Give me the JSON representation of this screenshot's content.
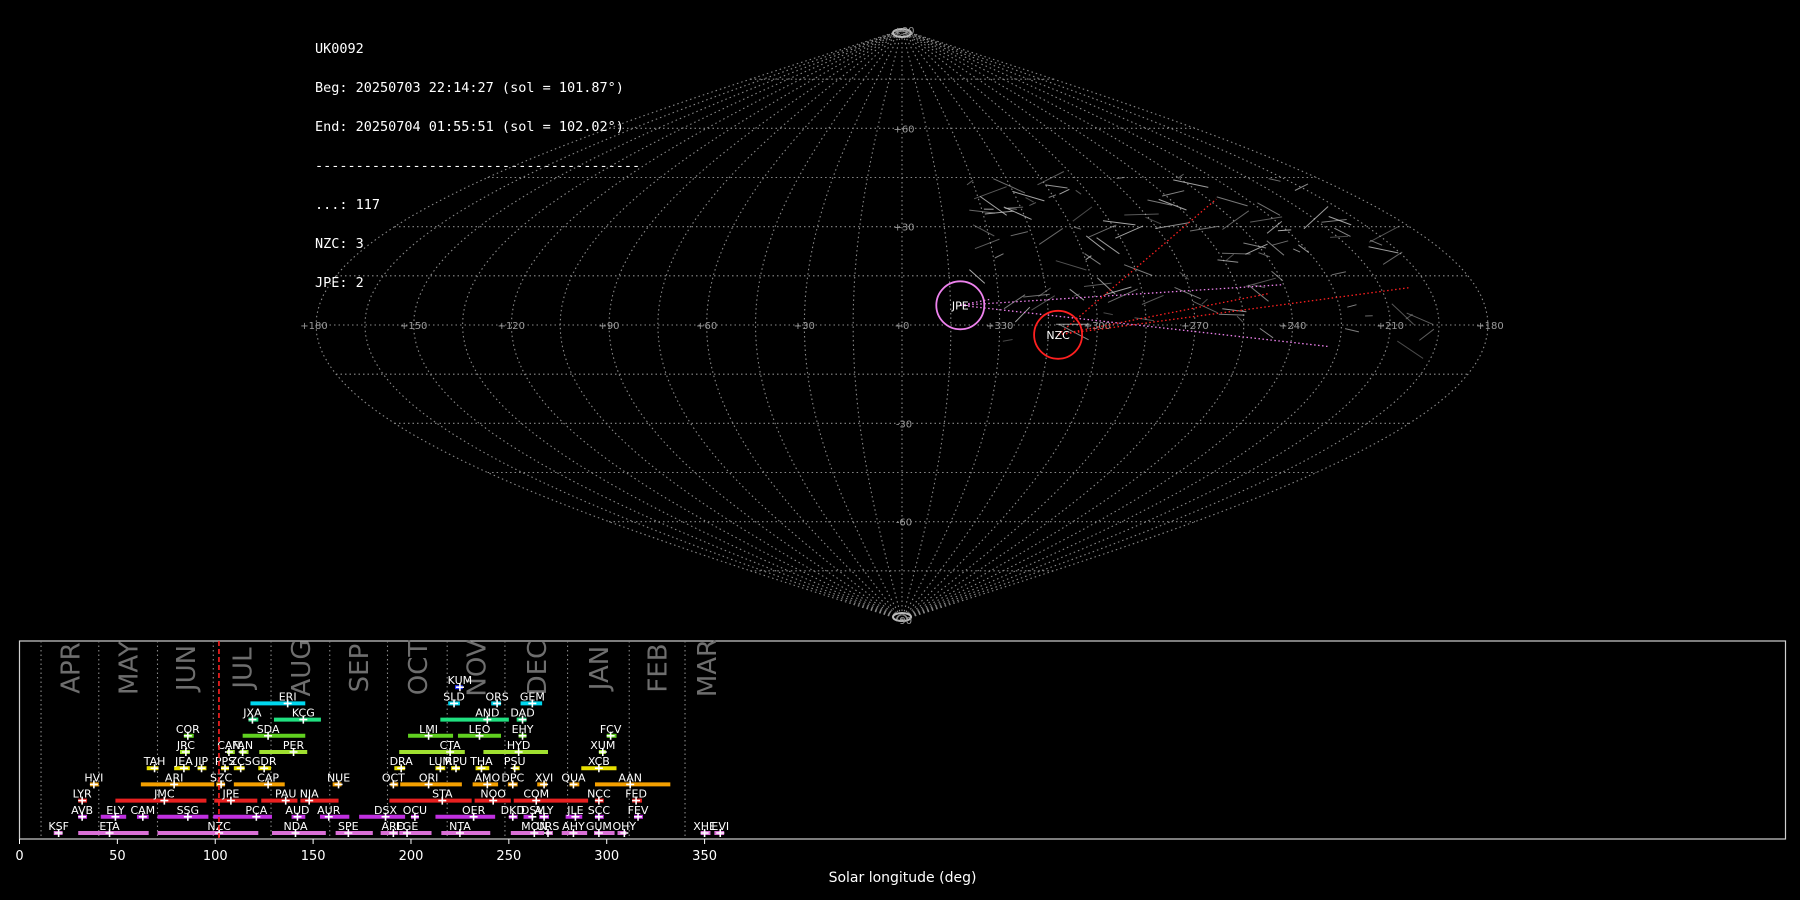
{
  "header": {
    "camera": "UK0092",
    "begin": "Beg: 20250703 22:14:27 (sol = 101.87°)",
    "end": "End: 20250704 01:55:51 (sol = 102.02°)",
    "separator": "----------------------------------------",
    "counts": [
      {
        "code": "...",
        "n": 117
      },
      {
        "code": "NZC",
        "n": 3
      },
      {
        "code": "JPE",
        "n": 2
      }
    ]
  },
  "colors": {
    "background": "#000000",
    "grid": "#8a8a8a",
    "JPE": "#ee82ee",
    "NZC": "#ff2020",
    "sporadic": "#c8c8c8"
  },
  "chart_data": [
    {
      "type": "scatter",
      "projection": "sinusoidal",
      "lon_ticks": [
        180,
        150,
        120,
        90,
        60,
        30,
        0,
        330,
        300,
        270,
        240,
        210,
        180
      ],
      "lon_tick_labels": [
        "+180",
        "+150",
        "+120",
        "+90",
        "+60",
        "+30",
        "+0",
        "+330",
        "+300",
        "+270",
        "+240",
        "+210",
        "+180"
      ],
      "lat_ticks": [
        90,
        60,
        30,
        -30,
        -60,
        -90
      ],
      "lat_tick_labels": [
        "+90",
        "+60",
        "+30",
        "-30",
        "-60",
        "-90"
      ],
      "radiants": [
        {
          "name": "JPE",
          "lon": 342,
          "lat": 6,
          "color": "#ee82ee"
        },
        {
          "name": "NZC",
          "lon": 312,
          "lat": -3,
          "color": "#ff2020"
        }
      ],
      "grid": true
    },
    {
      "type": "bar",
      "xlabel": "Solar longitude (deg)",
      "xlim": [
        0,
        362
      ],
      "x_ticks": [
        0,
        50,
        100,
        150,
        200,
        250,
        300,
        350
      ],
      "current_sol": 101.9,
      "months": [
        {
          "label": "APR",
          "start": 11
        },
        {
          "label": "MAY",
          "start": 40.5
        },
        {
          "label": "JUN",
          "start": 70.5
        },
        {
          "label": "JUL",
          "start": 99
        },
        {
          "label": "AUG",
          "start": 128.5
        },
        {
          "label": "SEP",
          "start": 158.5
        },
        {
          "label": "OCT",
          "start": 188
        },
        {
          "label": "NOV",
          "start": 218.5
        },
        {
          "label": "DEC",
          "start": 248
        },
        {
          "label": "JAN",
          "start": 280
        },
        {
          "label": "FEB",
          "start": 311.5
        },
        {
          "label": "MAR",
          "start": 340
        }
      ],
      "showers": [
        {
          "code": "KSF",
          "row": 0,
          "start": 17.5,
          "end": 22,
          "peak": 20,
          "color": "#da70d6"
        },
        {
          "code": "ETA",
          "row": 0,
          "start": 30,
          "end": 66,
          "peak": 46,
          "color": "#da70d6"
        },
        {
          "code": "NZC",
          "row": 0,
          "start": 70.5,
          "end": 122,
          "peak": 102,
          "color": "#da70d6"
        },
        {
          "code": "NDA",
          "row": 0,
          "start": 129,
          "end": 156.5,
          "peak": 141,
          "color": "#da70d6"
        },
        {
          "code": "SPE",
          "row": 0,
          "start": 161.5,
          "end": 180.5,
          "peak": 168,
          "color": "#da70d6"
        },
        {
          "code": "ARD",
          "row": 0,
          "start": 184.5,
          "end": 193.5,
          "peak": 191,
          "color": "#da70d6"
        },
        {
          "code": "EGE",
          "row": 0,
          "start": 194,
          "end": 210.5,
          "peak": 198,
          "color": "#da70d6"
        },
        {
          "code": "NTA",
          "row": 0,
          "start": 215.5,
          "end": 240.5,
          "peak": 225,
          "color": "#da70d6"
        },
        {
          "code": "MON",
          "row": 0,
          "start": 251,
          "end": 268,
          "peak": 263,
          "color": "#da70d6"
        },
        {
          "code": "URS",
          "row": 0,
          "start": 269,
          "end": 272.5,
          "peak": 270,
          "color": "#da70d6"
        },
        {
          "code": "AHY",
          "row": 0,
          "start": 277,
          "end": 290,
          "peak": 283,
          "color": "#da70d6"
        },
        {
          "code": "GUM",
          "row": 0,
          "start": 293.5,
          "end": 304,
          "peak": 296,
          "color": "#da70d6"
        },
        {
          "code": "OHY",
          "row": 0,
          "start": 305.5,
          "end": 310,
          "peak": 309,
          "color": "#da70d6"
        },
        {
          "code": "XHE",
          "row": 0,
          "start": 348,
          "end": 353,
          "peak": 350,
          "color": "#da70d6"
        },
        {
          "code": "EVI",
          "row": 0,
          "start": 355,
          "end": 360,
          "peak": 358,
          "color": "#da70d6"
        },
        {
          "code": "AVB",
          "row": 1,
          "start": 30,
          "end": 34.5,
          "peak": 32,
          "color": "#c030e0"
        },
        {
          "code": "ELY",
          "row": 1,
          "start": 41.5,
          "end": 54.5,
          "peak": 49,
          "color": "#c030e0"
        },
        {
          "code": "CAM",
          "row": 1,
          "start": 60,
          "end": 66,
          "peak": 63,
          "color": "#c030e0"
        },
        {
          "code": "SSG",
          "row": 1,
          "start": 70.5,
          "end": 96.5,
          "peak": 86,
          "color": "#c030e0"
        },
        {
          "code": "PCA",
          "row": 1,
          "start": 99,
          "end": 129,
          "peak": 121,
          "color": "#c030e0"
        },
        {
          "code": "AUD",
          "row": 1,
          "start": 139,
          "end": 146,
          "peak": 142,
          "color": "#c030e0"
        },
        {
          "code": "AUR",
          "row": 1,
          "start": 153.5,
          "end": 168.5,
          "peak": 158,
          "color": "#c030e0"
        },
        {
          "code": "DSX",
          "row": 1,
          "start": 173.5,
          "end": 197,
          "peak": 187,
          "color": "#c030e0"
        },
        {
          "code": "OCU",
          "row": 1,
          "start": 200,
          "end": 204,
          "peak": 202,
          "color": "#c030e0"
        },
        {
          "code": "OER",
          "row": 1,
          "start": 212.5,
          "end": 243,
          "peak": 232,
          "color": "#c030e0"
        },
        {
          "code": "DKD",
          "row": 1,
          "start": 250,
          "end": 254.5,
          "peak": 252,
          "color": "#c030e0"
        },
        {
          "code": "DSV",
          "row": 1,
          "start": 257.5,
          "end": 262.5,
          "peak": 262,
          "color": "#c030e0"
        },
        {
          "code": "ALY",
          "row": 1,
          "start": 265.5,
          "end": 270.5,
          "peak": 268,
          "color": "#c030e0"
        },
        {
          "code": "JLE",
          "row": 1,
          "start": 279,
          "end": 287.5,
          "peak": 284,
          "color": "#c030e0"
        },
        {
          "code": "SCC",
          "row": 1,
          "start": 294,
          "end": 298.5,
          "peak": 296,
          "color": "#c030e0"
        },
        {
          "code": "FEV",
          "row": 1,
          "start": 314,
          "end": 318.5,
          "peak": 316,
          "color": "#c030e0"
        },
        {
          "code": "LYR",
          "row": 2,
          "start": 30,
          "end": 34.5,
          "peak": 32,
          "color": "#e82020"
        },
        {
          "code": "JMC",
          "row": 2,
          "start": 49,
          "end": 95.5,
          "peak": 74,
          "color": "#e82020"
        },
        {
          "code": "JPE",
          "row": 2,
          "start": 99.5,
          "end": 121.5,
          "peak": 108,
          "color": "#e82020"
        },
        {
          "code": "PAU",
          "row": 2,
          "start": 123.5,
          "end": 142,
          "peak": 136,
          "color": "#e82020"
        },
        {
          "code": "NIA",
          "row": 2,
          "start": 143.5,
          "end": 163,
          "peak": 148,
          "color": "#e82020"
        },
        {
          "code": "STA",
          "row": 2,
          "start": 189,
          "end": 231,
          "peak": 216,
          "color": "#e82020"
        },
        {
          "code": "NOO",
          "row": 2,
          "start": 232.5,
          "end": 251,
          "peak": 242,
          "color": "#e82020"
        },
        {
          "code": "COM",
          "row": 2,
          "start": 252.5,
          "end": 290.5,
          "peak": 264,
          "color": "#e82020"
        },
        {
          "code": "NCC",
          "row": 2,
          "start": 294,
          "end": 298.5,
          "peak": 296,
          "color": "#e82020"
        },
        {
          "code": "FED",
          "row": 2,
          "start": 313,
          "end": 318,
          "peak": 315,
          "color": "#e82020"
        },
        {
          "code": "HVI",
          "row": 3,
          "start": 36,
          "end": 40.5,
          "peak": 38,
          "color": "#f5a000"
        },
        {
          "code": "ARI",
          "row": 3,
          "start": 62,
          "end": 99.5,
          "peak": 79,
          "color": "#f5a000"
        },
        {
          "code": "SZC",
          "row": 3,
          "start": 100.5,
          "end": 105,
          "peak": 103,
          "color": "#f5a000"
        },
        {
          "code": "CAP",
          "row": 3,
          "start": 109.5,
          "end": 135.5,
          "peak": 127,
          "color": "#f5a000"
        },
        {
          "code": "NUE",
          "row": 3,
          "start": 160,
          "end": 164.5,
          "peak": 163,
          "color": "#f5a000"
        },
        {
          "code": "OCT",
          "row": 3,
          "start": 189.5,
          "end": 193.5,
          "peak": 191,
          "color": "#f5a000"
        },
        {
          "code": "ORI",
          "row": 3,
          "start": 194.5,
          "end": 226,
          "peak": 209,
          "color": "#f5a000"
        },
        {
          "code": "AMO",
          "row": 3,
          "start": 231.5,
          "end": 244.5,
          "peak": 239,
          "color": "#f5a000"
        },
        {
          "code": "DPC",
          "row": 3,
          "start": 249.5,
          "end": 254.5,
          "peak": 252,
          "color": "#f5a000"
        },
        {
          "code": "XVI",
          "row": 3,
          "start": 264.5,
          "end": 269.5,
          "peak": 268,
          "color": "#f5a000"
        },
        {
          "code": "QUA",
          "row": 3,
          "start": 281,
          "end": 286,
          "peak": 283,
          "color": "#f5a000"
        },
        {
          "code": "AAN",
          "row": 3,
          "start": 294,
          "end": 332.5,
          "peak": 312,
          "color": "#f5a000"
        },
        {
          "code": "TAH",
          "row": 4,
          "start": 65,
          "end": 71,
          "peak": 69,
          "color": "#e8e000"
        },
        {
          "code": "JEA",
          "row": 4,
          "start": 79,
          "end": 87,
          "peak": 84,
          "color": "#e8e000"
        },
        {
          "code": "JIP",
          "row": 4,
          "start": 91,
          "end": 95.5,
          "peak": 93,
          "color": "#e8e000"
        },
        {
          "code": "PPS",
          "row": 4,
          "start": 103,
          "end": 107,
          "peak": 105,
          "color": "#e8e000"
        },
        {
          "code": "ZCS",
          "row": 4,
          "start": 109.5,
          "end": 115,
          "peak": 113,
          "color": "#e8e000"
        },
        {
          "code": "GDR",
          "row": 4,
          "start": 122,
          "end": 128.5,
          "peak": 125,
          "color": "#e8e000"
        },
        {
          "code": "DRA",
          "row": 4,
          "start": 191.5,
          "end": 197,
          "peak": 195,
          "color": "#e8e000"
        },
        {
          "code": "LUM",
          "row": 4,
          "start": 212.5,
          "end": 217.5,
          "peak": 215,
          "color": "#e8e000"
        },
        {
          "code": "RPU",
          "row": 4,
          "start": 220.5,
          "end": 225,
          "peak": 223,
          "color": "#e8e000"
        },
        {
          "code": "THA",
          "row": 4,
          "start": 233,
          "end": 240,
          "peak": 236,
          "color": "#e8e000"
        },
        {
          "code": "PSU",
          "row": 4,
          "start": 252,
          "end": 255.5,
          "peak": 253,
          "color": "#e8e000"
        },
        {
          "code": "XCB",
          "row": 4,
          "start": 287,
          "end": 305,
          "peak": 296,
          "color": "#e8e000"
        },
        {
          "code": "JRC",
          "row": 5,
          "start": 82,
          "end": 87,
          "peak": 85,
          "color": "#a0e030"
        },
        {
          "code": "CAN",
          "row": 5,
          "start": 106,
          "end": 110,
          "peak": 107,
          "color": "#a0e030"
        },
        {
          "code": "FAN",
          "row": 5,
          "start": 112.5,
          "end": 117,
          "peak": 114,
          "color": "#a0e030"
        },
        {
          "code": "PER",
          "row": 5,
          "start": 122.5,
          "end": 147,
          "peak": 140,
          "color": "#a0e030"
        },
        {
          "code": "CTA",
          "row": 5,
          "start": 194,
          "end": 227.5,
          "peak": 220,
          "color": "#a0e030"
        },
        {
          "code": "HYD",
          "row": 5,
          "start": 237,
          "end": 270,
          "peak": 255,
          "color": "#a0e030"
        },
        {
          "code": "XUM",
          "row": 5,
          "start": 296,
          "end": 299.5,
          "peak": 298,
          "color": "#a0e030"
        },
        {
          "code": "COR",
          "row": 6,
          "start": 84,
          "end": 89,
          "peak": 86,
          "color": "#60d020"
        },
        {
          "code": "SDA",
          "row": 6,
          "start": 114,
          "end": 146,
          "peak": 127,
          "color": "#60d020"
        },
        {
          "code": "LMI",
          "row": 6,
          "start": 198.5,
          "end": 221.5,
          "peak": 209,
          "color": "#60d020"
        },
        {
          "code": "LEO",
          "row": 6,
          "start": 224,
          "end": 246,
          "peak": 235,
          "color": "#60d020"
        },
        {
          "code": "EHY",
          "row": 6,
          "start": 255,
          "end": 259,
          "peak": 257,
          "color": "#60d020"
        },
        {
          "code": "FCV",
          "row": 6,
          "start": 300,
          "end": 305,
          "peak": 302,
          "color": "#60d020"
        },
        {
          "code": "JXA",
          "row": 7,
          "start": 117,
          "end": 122,
          "peak": 119,
          "color": "#20e080"
        },
        {
          "code": "KCG",
          "row": 7,
          "start": 130,
          "end": 154,
          "peak": 145,
          "color": "#20e080"
        },
        {
          "code": "AND",
          "row": 7,
          "start": 215,
          "end": 250,
          "peak": 239,
          "color": "#20e080"
        },
        {
          "code": "DAD",
          "row": 7,
          "start": 254,
          "end": 259,
          "peak": 257,
          "color": "#20e080"
        },
        {
          "code": "ERI",
          "row": 8,
          "start": 118,
          "end": 146,
          "peak": 137,
          "color": "#00d8f0"
        },
        {
          "code": "SLD",
          "row": 8,
          "start": 219,
          "end": 225,
          "peak": 222,
          "color": "#00d8f0"
        },
        {
          "code": "ORS",
          "row": 8,
          "start": 241,
          "end": 246,
          "peak": 244,
          "color": "#00d8f0"
        },
        {
          "code": "GEM",
          "row": 8,
          "start": 256,
          "end": 267,
          "peak": 262,
          "color": "#00d8f0"
        },
        {
          "code": "KUM",
          "row": 9,
          "start": 222.5,
          "end": 226.5,
          "peak": 225,
          "color": "#2030ff"
        }
      ]
    }
  ]
}
